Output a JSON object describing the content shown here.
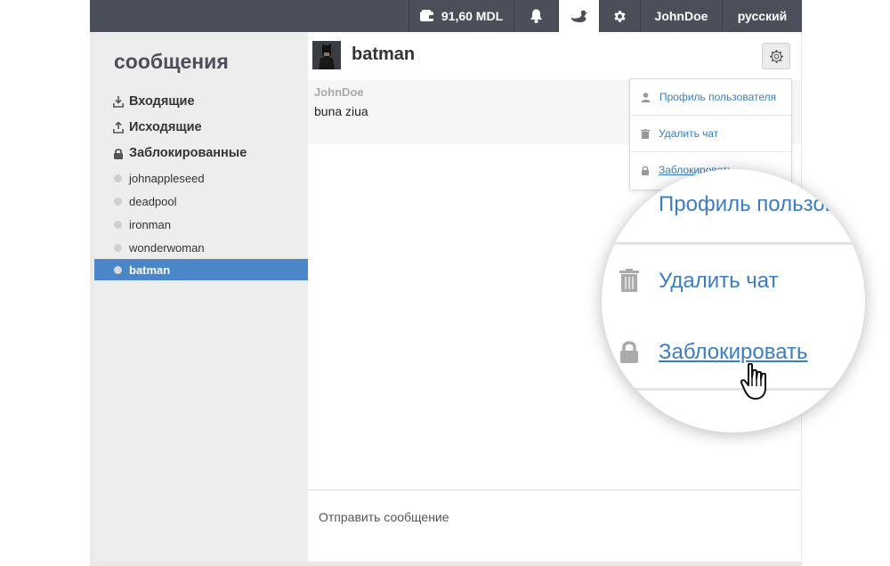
{
  "topbar": {
    "balance": "91,60 MDL",
    "username": "JohnDoe",
    "language": "русский"
  },
  "sidebar": {
    "title": "сообщения",
    "links": [
      {
        "label": "Входящие",
        "icon": "inbox-download-icon"
      },
      {
        "label": "Исходящие",
        "icon": "outbox-upload-icon"
      },
      {
        "label": "Заблокированные",
        "icon": "lock-icon"
      }
    ],
    "users": [
      "johnappleseed",
      "deadpool",
      "ironman",
      "wonderwoman",
      "batman"
    ],
    "active_user": "batman"
  },
  "chat": {
    "name": "batman",
    "messages": [
      {
        "author": "JohnDoe",
        "text": "buna ziua"
      }
    ],
    "input_placeholder": "Отправить сообщение"
  },
  "menu": {
    "profile": "Профиль пользователя",
    "delete": "Удалить чат",
    "block": "Заблокировать"
  },
  "magnifier": {
    "profile": "Профиль пользователя",
    "delete": "Удалить чат",
    "block": "Заблокировать"
  },
  "colors": {
    "topbar": "#4a4f59",
    "accent": "#4a86c8",
    "link": "#3a7dc4"
  }
}
